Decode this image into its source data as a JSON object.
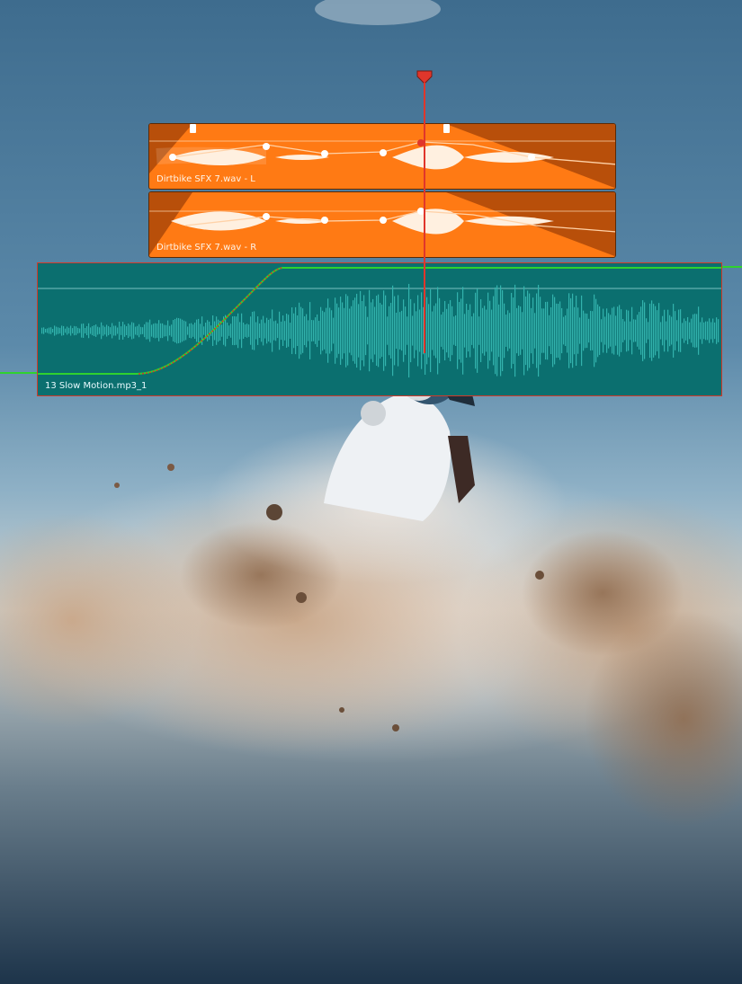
{
  "timeline": {
    "clips": [
      {
        "label": "Dirtbike SFX 7.wav - L",
        "track": "audio",
        "color": "#ff7a14"
      },
      {
        "label": "Dirtbike SFX 7.wav - R",
        "track": "audio",
        "color": "#ff7a14"
      },
      {
        "label": "13 Slow Motion.mp3_1",
        "track": "audio",
        "color": "#0b6f6f"
      }
    ],
    "colors": {
      "sfx_clip": "#ff7a14",
      "sfx_fade": "#b84f0a",
      "music_clip": "#0b6f6f",
      "music_waveform": "#33b3ad",
      "volume_line": "#2fd22f",
      "playhead": "#e0362b"
    },
    "icons": [
      "playhead-marker-icon",
      "fade-handle-icon",
      "keyframe-icon"
    ]
  }
}
